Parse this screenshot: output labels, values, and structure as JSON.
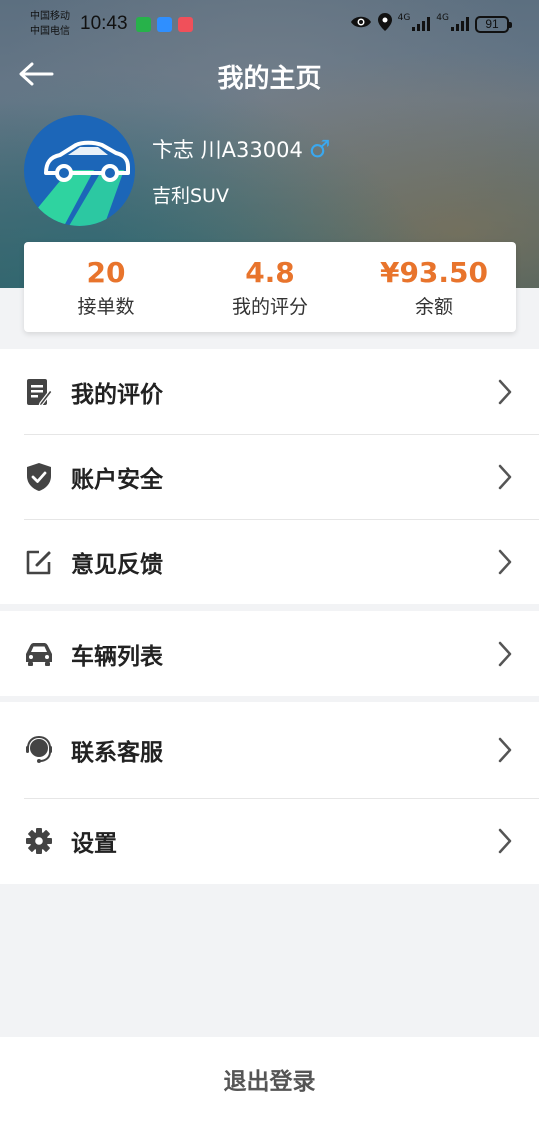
{
  "status_bar": {
    "carrier_1": "中国移动",
    "carrier_2": "中国电信",
    "time": "10:43",
    "network_1": "4G",
    "network_2": "4G",
    "battery": "91"
  },
  "header": {
    "title": "我的主页"
  },
  "profile": {
    "name": "卞志 川A33004",
    "car_model": "吉利SUV",
    "gender_icon": "male-icon"
  },
  "stats": [
    {
      "value": "20",
      "label": "接单数"
    },
    {
      "value": "4.8",
      "label": "我的评分"
    },
    {
      "value": "¥93.50",
      "label": "余额"
    }
  ],
  "menu": {
    "group1": [
      {
        "label": "我的评价",
        "icon": "review-list-icon"
      },
      {
        "label": "账户安全",
        "icon": "shield-check-icon"
      },
      {
        "label": "意见反馈",
        "icon": "edit-icon"
      }
    ],
    "group2": [
      {
        "label": "车辆列表",
        "icon": "car-icon"
      }
    ],
    "group3": [
      {
        "label": "联系客服",
        "icon": "headset-icon"
      },
      {
        "label": "设置",
        "icon": "gear-icon"
      }
    ]
  },
  "logout_label": "退出登录",
  "colors": {
    "accent_orange": "#e8742c",
    "gender_blue": "#3aa8f0",
    "avatar_blue": "#1c66b8",
    "avatar_green": "#2fd3a0"
  }
}
